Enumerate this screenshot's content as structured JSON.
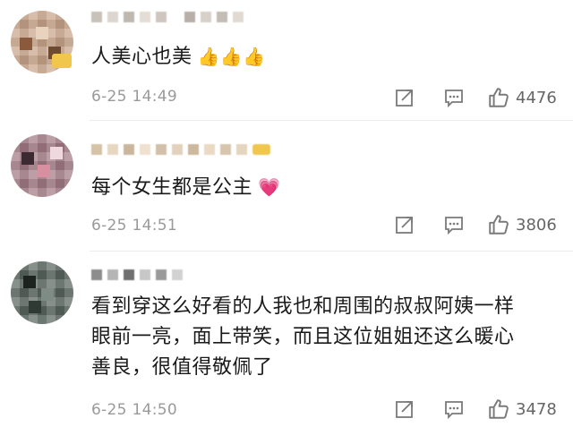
{
  "comments": [
    {
      "text": "人美心也美",
      "emojis": "👍👍👍",
      "time": "6-25 14:49",
      "likes": "4476"
    },
    {
      "text": "每个女生都是公主",
      "emojis": "💗",
      "time": "6-25 14:51",
      "likes": "3806"
    },
    {
      "text_lines": [
        "看到穿这么好看的人我也和周围的叔叔阿姨一样",
        "眼前一亮，面上带笑，而且这位姐姐还这么暖心",
        "善良，很值得敬佩了"
      ],
      "time": "6-25 14:50",
      "likes": "3478"
    }
  ],
  "icons": {
    "share": "share-icon",
    "comment": "comment-icon",
    "like": "thumbs-up-icon"
  },
  "colors": {
    "meta_text": "#9a9a9a",
    "body_text": "#1a1a1a",
    "icon": "#7a7a7a"
  }
}
